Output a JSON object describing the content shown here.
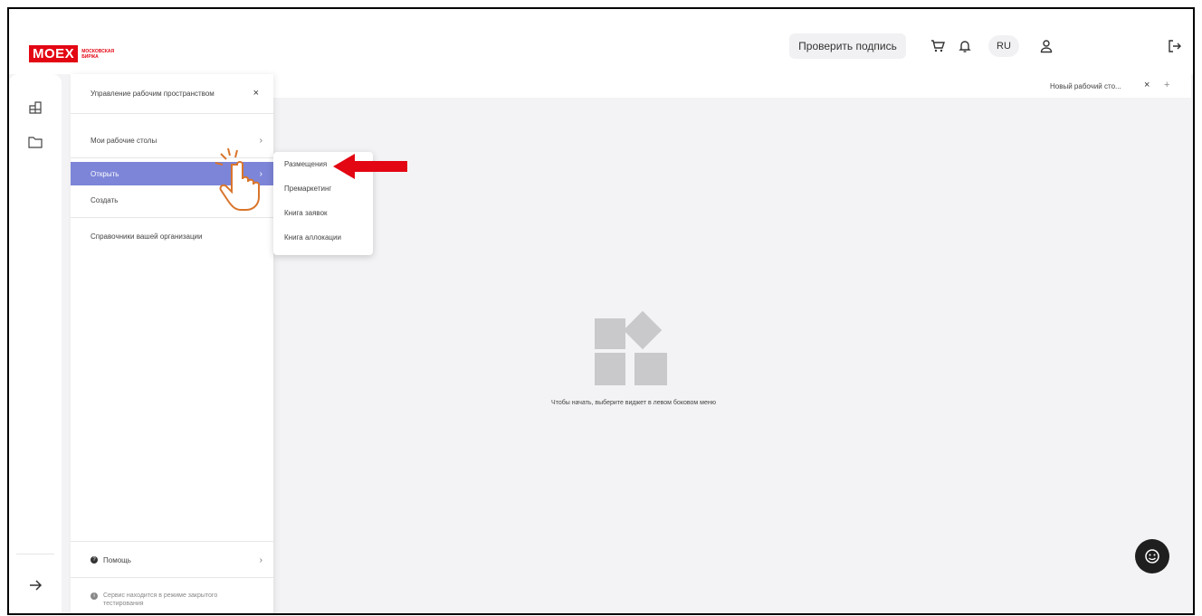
{
  "header": {
    "logo_text": "MOEX",
    "logo_subtitle": "МОСКОВСКАЯ БИРЖА",
    "check_signature_label": "Проверить подпись",
    "lang_label": "RU",
    "icons": [
      "cart-icon",
      "bell-icon",
      "user-icon",
      "logout-icon"
    ]
  },
  "tabs": [
    {
      "label": "Новый рабочий сто...",
      "close": "×",
      "add": "+"
    }
  ],
  "panel": {
    "title": "Управление рабочим пространством",
    "close": "×",
    "items": [
      {
        "label": "Мои рабочие столы",
        "chevron": "›"
      },
      {
        "label": "Открыть",
        "chevron": "›",
        "active": true
      },
      {
        "label": "Создать"
      },
      {
        "label": "Справочники вашей организации"
      }
    ],
    "help_label": "Помощь",
    "help_chevron": "›",
    "status_text": "Сервис находится в режиме закрытого тестирования"
  },
  "submenu": {
    "items": [
      "Размещения",
      "Премаркетинг",
      "Книга заявок",
      "Книга аллокации"
    ]
  },
  "main": {
    "empty_text": "Чтобы начать, выберите виджет в левом боковом меню"
  },
  "colors": {
    "brand": "#e30613",
    "active_item": "#7c85d8",
    "annotation_arrow": "#e30613",
    "annotation_hand": "#d9752b"
  }
}
